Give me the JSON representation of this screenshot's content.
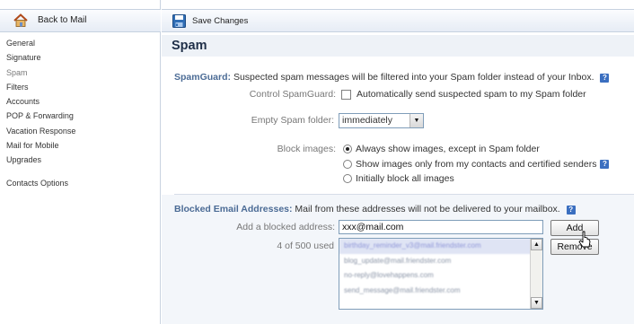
{
  "sidebar": {
    "back_label": "Back to Mail",
    "items": [
      {
        "label": "General"
      },
      {
        "label": "Signature"
      },
      {
        "label": "Spam"
      },
      {
        "label": "Filters"
      },
      {
        "label": "Accounts"
      },
      {
        "label": "POP & Forwarding"
      },
      {
        "label": "Vacation Response"
      },
      {
        "label": "Mail for Mobile"
      },
      {
        "label": "Upgrades"
      },
      {
        "label": "Contacts Options"
      }
    ]
  },
  "toolbar": {
    "save_label": "Save Changes"
  },
  "page": {
    "title": "Spam"
  },
  "spamguard": {
    "lead": "SpamGuard:",
    "description": "Suspected spam messages will be filtered into your Spam folder instead of your Inbox.",
    "control_label": "Control SpamGuard:",
    "control_option": "Automatically send suspected spam to my Spam folder",
    "empty_label": "Empty Spam folder:",
    "empty_value": "immediately",
    "block_label": "Block images:",
    "block_options": [
      "Always show images, except in Spam folder",
      "Show images only from my contacts and certified senders",
      "Initially block all images"
    ],
    "block_selected": "Always show images, except in Spam folder"
  },
  "blocked": {
    "lead": "Blocked Email Addresses:",
    "description": "Mail from these addresses will not be delivered to your mailbox.",
    "add_label": "Add a blocked address:",
    "input_value": "xxx@mail.com",
    "add_button": "Add",
    "remove_button": "Remove",
    "count": "4 of 500 used",
    "addresses": [
      "birthday_reminder_v3@mail.friendster.com",
      "blog_update@mail.friendster.com",
      "no-reply@lovehappens.com",
      "send_message@mail.friendster.com"
    ]
  },
  "colors": {
    "accent": "#4b6b95",
    "sidebar_border": "#c9d3e0",
    "help": "#3b6fc0"
  },
  "icons": {
    "home": "home-icon",
    "save": "floppy-disk-icon",
    "help": "help-icon",
    "cursor": "mouse-pointer-icon"
  }
}
